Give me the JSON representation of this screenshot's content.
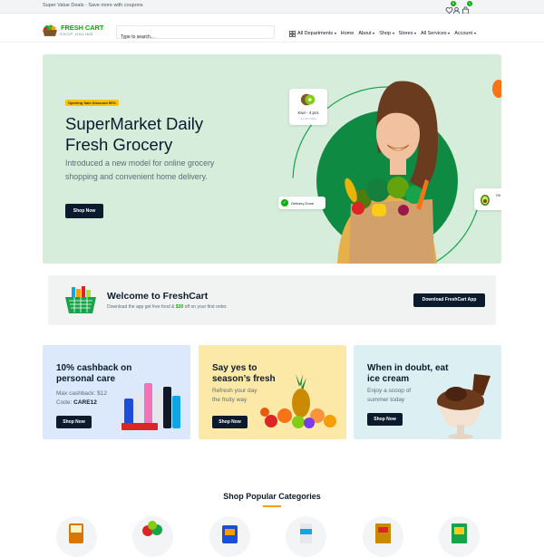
{
  "topbar": {
    "message": "Super Value Deals - Save more with coupons",
    "wishlist_count": "5",
    "cart_count": "1"
  },
  "header": {
    "logo_name": "FRESH CART",
    "logo_tagline": "SHOP ONLINE",
    "search_placeholder": "Type to search...",
    "departments_label": "All Departments",
    "nav": [
      {
        "label": "Home",
        "dropdown": false
      },
      {
        "label": "About",
        "dropdown": true
      },
      {
        "label": "Shop",
        "dropdown": true
      },
      {
        "label": "Stores",
        "dropdown": true
      },
      {
        "label": "All Services",
        "dropdown": true
      },
      {
        "label": "Account",
        "dropdown": true
      }
    ]
  },
  "hero": {
    "badge": "Opening Sale Discount 50%",
    "title": "SuperMarket Daily Fresh Grocery",
    "subtitle": "Introduced a new model for online grocery shopping and convenient home delivery.",
    "button": "Shop Now",
    "kiwi_label": "Kiwi - 4 pcs",
    "kiwi_sub": "$ 4.99 / 500g",
    "delivery_label": "Delivery Done",
    "avocado_label": "Av"
  },
  "welcome": {
    "title": "Welcome to FreshCart",
    "text_before": "Download the app get free food & ",
    "highlight": "$30",
    "text_after": " off on your first order.",
    "button": "Download FreshCart App"
  },
  "promos": [
    {
      "title": "10% cashback on personal care",
      "line1": "Max cashback: $12",
      "code_label": "Code: ",
      "code": "CARE12",
      "button": "Shop Now",
      "bg": "#dce8fc"
    },
    {
      "title": "Say yes to season’s fresh",
      "line1": "Refresh your day",
      "line2": "the fruity way",
      "button": "Shop Now",
      "bg": "#fde9a7"
    },
    {
      "title": "When in doubt, eat ice cream",
      "line1": "Enjoy a scoop of",
      "line2": "summer today",
      "button": "Shop Now",
      "bg": "#dcf0f3"
    }
  ],
  "categories": {
    "title": "Shop Popular Categories"
  },
  "colors": {
    "brand_green": "#0aad0a",
    "dark": "#0b1b2d",
    "hero_bg": "#d6eddb",
    "accent_yellow": "#ffc107"
  }
}
